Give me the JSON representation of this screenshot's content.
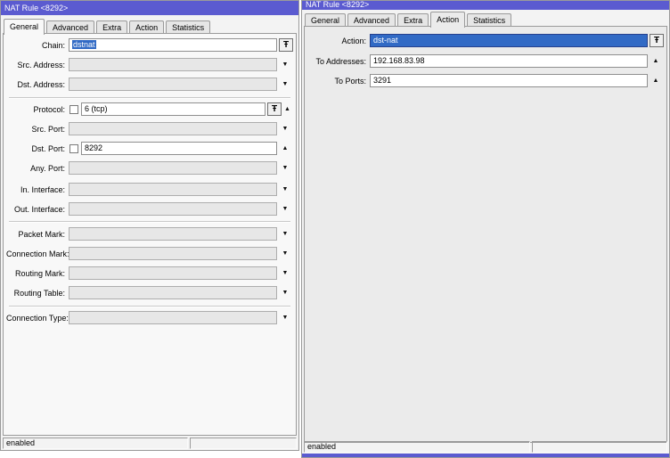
{
  "left_window": {
    "title": "NAT Rule <8292>",
    "tabs": [
      "General",
      "Advanced",
      "Extra",
      "Action",
      "Statistics"
    ],
    "selected_tab": "General",
    "fields": {
      "chain": {
        "label": "Chain:",
        "value": "dstnat"
      },
      "src_address": {
        "label": "Src. Address:",
        "value": ""
      },
      "dst_address": {
        "label": "Dst. Address:",
        "value": ""
      },
      "protocol": {
        "label": "Protocol:",
        "value": "6 (tcp)",
        "checkbox_checked": false
      },
      "src_port": {
        "label": "Src. Port:",
        "value": ""
      },
      "dst_port": {
        "label": "Dst. Port:",
        "value": "8292",
        "checkbox_checked": false
      },
      "any_port": {
        "label": "Any. Port:",
        "value": ""
      },
      "in_interface": {
        "label": "In. Interface:",
        "value": ""
      },
      "out_interface": {
        "label": "Out. Interface:",
        "value": ""
      },
      "packet_mark": {
        "label": "Packet Mark:",
        "value": ""
      },
      "connection_mark": {
        "label": "Connection Mark:",
        "value": ""
      },
      "routing_mark": {
        "label": "Routing Mark:",
        "value": ""
      },
      "routing_table": {
        "label": "Routing Table:",
        "value": ""
      },
      "connection_type": {
        "label": "Connection Type:",
        "value": ""
      }
    },
    "status_text": "enabled"
  },
  "right_window": {
    "title": "NAT Rule <8292>",
    "tabs": [
      "General",
      "Advanced",
      "Extra",
      "Action",
      "Statistics"
    ],
    "selected_tab": "Action",
    "fields": {
      "action": {
        "label": "Action:",
        "value": "dst-nat"
      },
      "to_addresses": {
        "label": "To Addresses:",
        "value": "192.168.83.98"
      },
      "to_ports": {
        "label": "To Ports:",
        "value": "3291"
      }
    },
    "status_text": "enabled"
  },
  "icons": {
    "dropdown_list_icon": "Ŧ",
    "arrow_down_icon": "▼",
    "arrow_up_icon": "▲"
  },
  "colors": {
    "titlebar_blue": "#5b5bd0",
    "selection_blue": "#316ac5"
  }
}
